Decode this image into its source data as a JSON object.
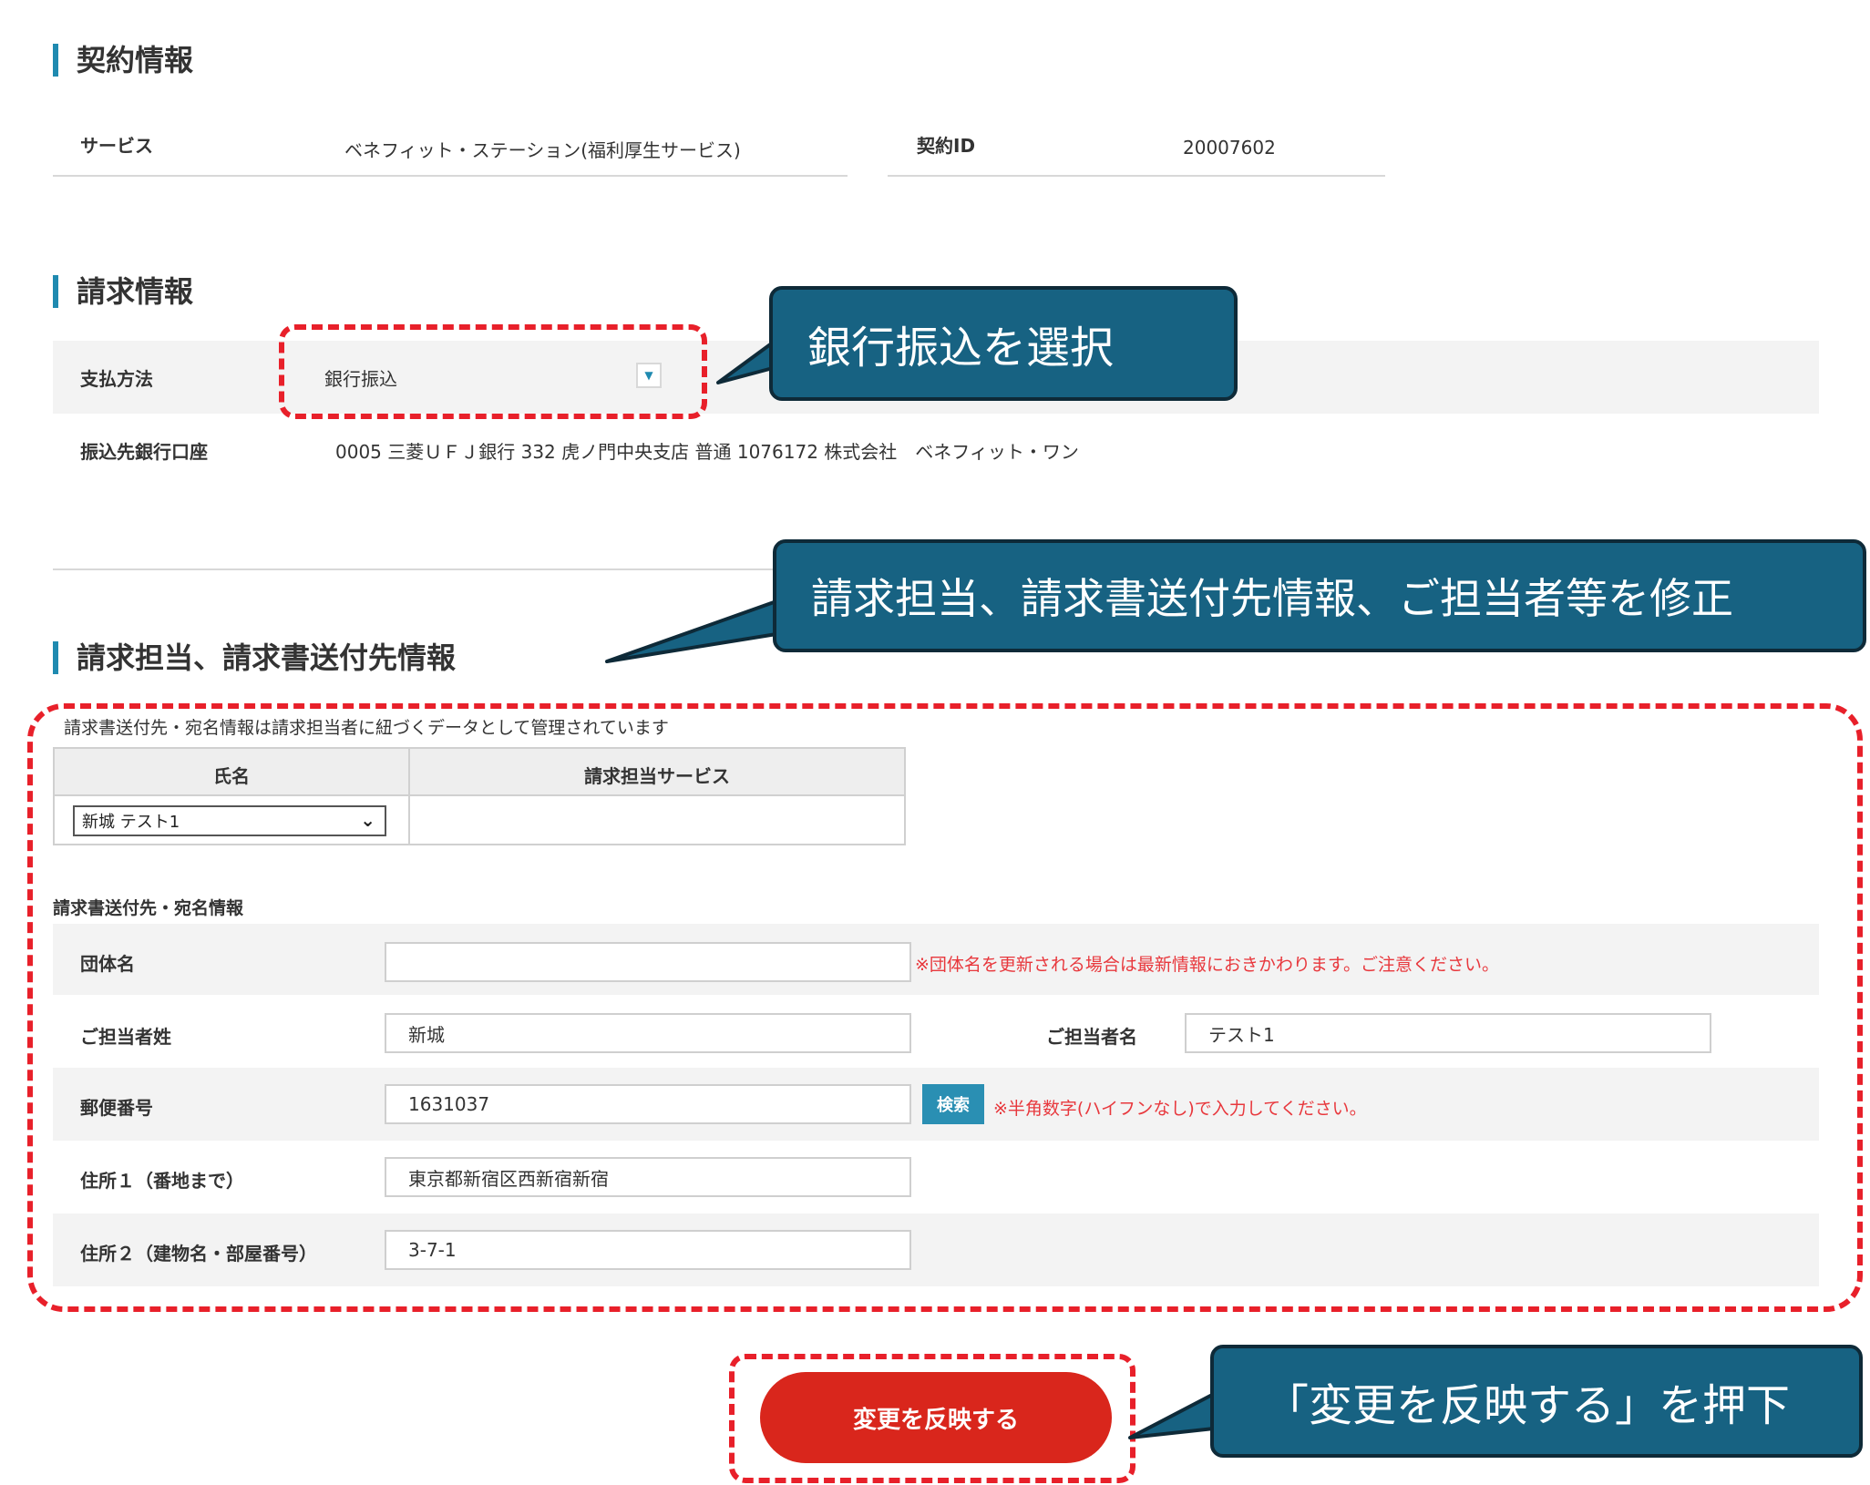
{
  "contract": {
    "title": "契約情報",
    "service_label": "サービス",
    "service_value": "ベネフィット・ステーション(福利厚生サービス)",
    "id_label": "契約ID",
    "id_value": "20007602"
  },
  "billing": {
    "title": "請求情報",
    "payment_label": "支払方法",
    "payment_value": "銀行振込",
    "account_label": "振込先銀行口座",
    "account_value": "0005 三菱ＵＦＪ銀行 332 虎ノ門中央支店 普通 1076172 株式会社　ベネフィット・ワン"
  },
  "contact": {
    "title": "請求担当、請求書送付先情報",
    "description": "請求書送付先・宛名情報は請求担当者に紐づくデータとして管理されています",
    "table_headers": [
      "氏名",
      "請求担当サービス"
    ],
    "selected_person": "新城 テスト1",
    "service_cell": "",
    "subheading": "請求書送付先・宛名情報",
    "org_label": "団体名",
    "org_value": "",
    "org_note": "※団体名を更新される場合は最新情報におきかわります。ご注意ください。",
    "last_name_label": "ご担当者姓",
    "last_name_value": "新城",
    "first_name_label": "ご担当者名",
    "first_name_value": "テスト1",
    "postal_label": "郵便番号",
    "postal_value": "1631037",
    "search_label": "検索",
    "postal_note": "※半角数字(ハイフンなし)で入力してください。",
    "address1_label": "住所１（番地まで）",
    "address1_value": "東京都新宿区西新宿新宿",
    "address2_label": "住所２（建物名・部屋番号）",
    "address2_value": "3-7-1"
  },
  "submit_label": "変更を反映する",
  "callouts": {
    "payment": "銀行振込を選択",
    "contact": "請求担当、請求書送付先情報、ご担当者等を修正",
    "submit": "「変更を反映する」を押下"
  },
  "colors": {
    "accent": "#1f8ab0",
    "callout_bg": "#176282",
    "highlight_red": "#e8202a",
    "submit_red": "#d9261c",
    "note_red": "#e8383d"
  }
}
